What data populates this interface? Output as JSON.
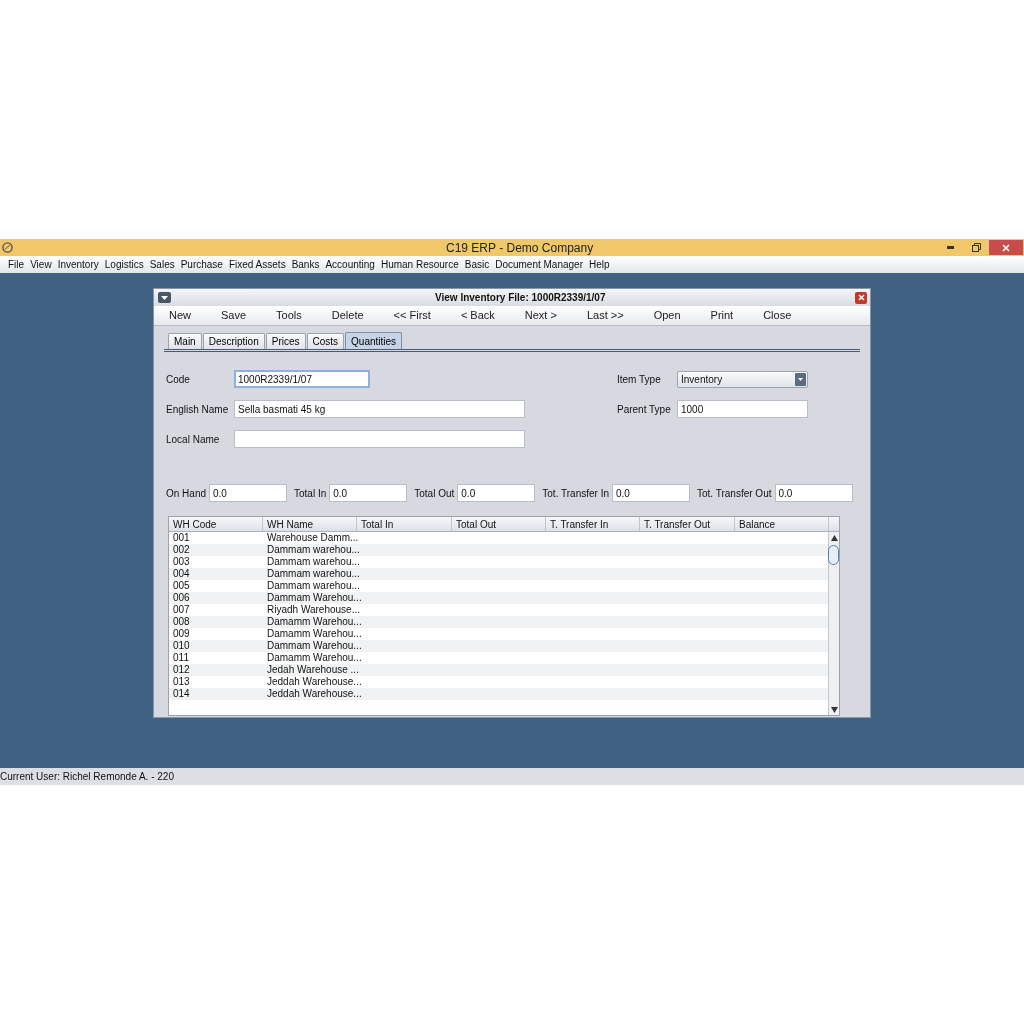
{
  "window": {
    "title": "C19 ERP - Demo Company"
  },
  "menu": [
    "File",
    "View",
    "Inventory",
    "Logistics",
    "Sales",
    "Purchase",
    "Fixed Assets",
    "Banks",
    "Accounting",
    "Human Resource",
    "Basic",
    "Document Manager",
    "Help"
  ],
  "dialog": {
    "title": "View Inventory File: 1000R2339/1/07",
    "toolbar": [
      "New",
      "Save",
      "Tools",
      "Delete",
      "<< First",
      "< Back",
      "Next >",
      "Last >>",
      "Open",
      "Print",
      "Close"
    ],
    "tabs": [
      {
        "label": "Main",
        "selected": false
      },
      {
        "label": "Description",
        "selected": false
      },
      {
        "label": "Prices",
        "selected": false
      },
      {
        "label": "Costs",
        "selected": false
      },
      {
        "label": "Quantities",
        "selected": true
      }
    ],
    "fields_left": [
      {
        "label": "Code",
        "value": "1000R2339/1/07",
        "focused": true
      },
      {
        "label": "English Name",
        "value": "Sella basmati 45 kg",
        "focused": false
      },
      {
        "label": "Local Name",
        "focused": false
      }
    ],
    "item_type": {
      "label": "Item Type",
      "value": "Inventory"
    },
    "parent_type": {
      "label": "Parent Type",
      "value": "1000"
    },
    "totals": [
      {
        "label": "On Hand",
        "value": "0.0"
      },
      {
        "label": "Total In",
        "value": "0.0"
      },
      {
        "label": "Total Out",
        "value": "0.0"
      },
      {
        "label": "Tot. Transfer In",
        "value": "0.0"
      },
      {
        "label": "Tot. Transfer Out",
        "value": "0.0"
      }
    ],
    "table": {
      "columns": [
        "WH Code",
        "WH Name",
        "Total In",
        "Total Out",
        "T. Transfer In",
        "T. Transfer Out",
        "Balance"
      ],
      "rows": [
        [
          "001",
          "Warehouse Damm..."
        ],
        [
          "002",
          "Dammam warehou..."
        ],
        [
          "003",
          "Dammam warehou..."
        ],
        [
          "004",
          "Dammam warehou..."
        ],
        [
          "005",
          "Dammam warehou..."
        ],
        [
          "006",
          "Dammam Warehou..."
        ],
        [
          "007",
          "Riyadh Warehouse..."
        ],
        [
          "008",
          "Damamm Warehou..."
        ],
        [
          "009",
          "Damamm Warehou..."
        ],
        [
          "010",
          "Dammam Warehou..."
        ],
        [
          "011",
          "Damamm Warehou..."
        ],
        [
          "012",
          "Jedah Warehouse ..."
        ],
        [
          "013",
          "Jeddah Warehouse..."
        ],
        [
          "014",
          "Jeddah Warehouse..."
        ]
      ]
    }
  },
  "status_bar": "Current User: Richel Remonde A. - 220"
}
